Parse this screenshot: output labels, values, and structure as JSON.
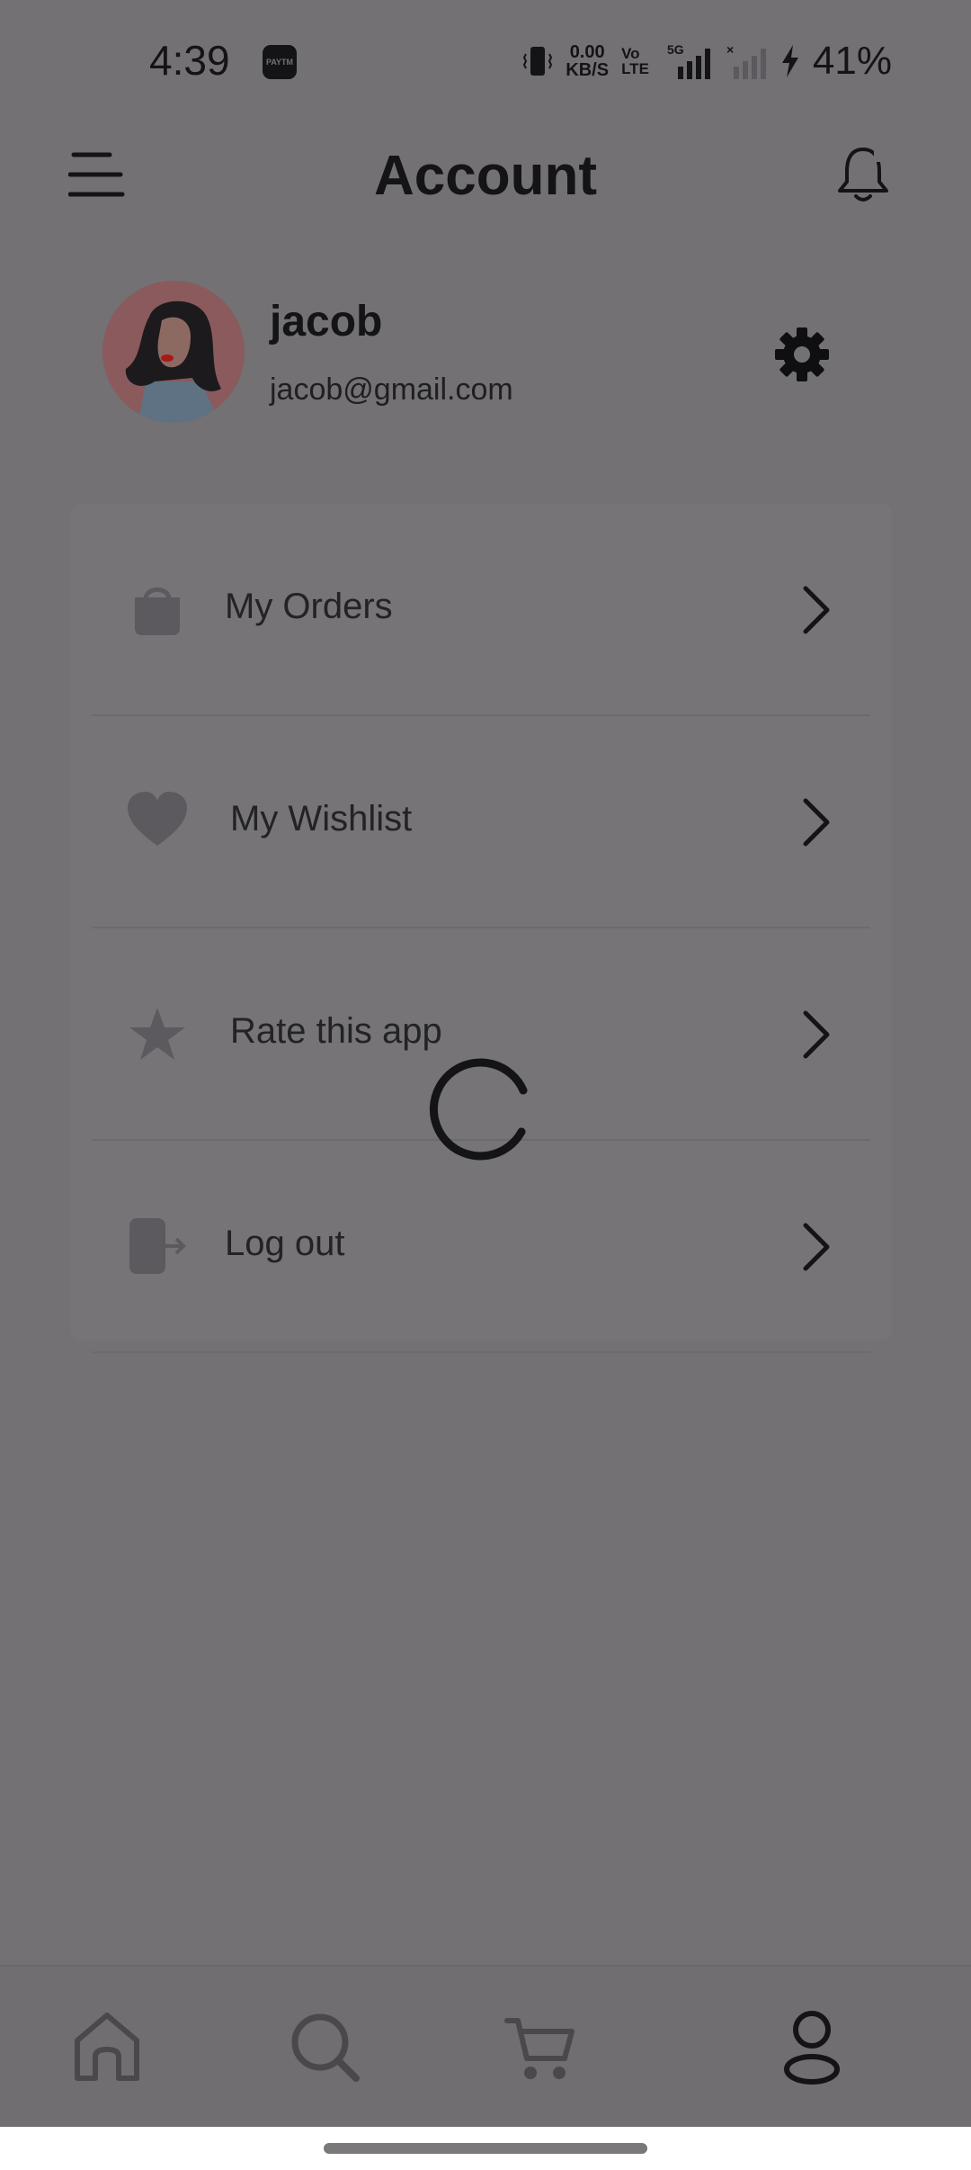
{
  "status_bar": {
    "time": "4:39",
    "paytm_label": "PAYTM",
    "net_speed_value": "0.00",
    "net_speed_unit": "KB/S",
    "volte_top": "Vo",
    "volte_bottom": "LTE",
    "network": "5G",
    "battery": "41%"
  },
  "header": {
    "title": "Account"
  },
  "profile": {
    "name": "jacob",
    "email": "jacob@gmail.com"
  },
  "menu": {
    "items": [
      {
        "label": "My Orders",
        "icon": "shopping-bag-icon"
      },
      {
        "label": "My Wishlist",
        "icon": "heart-icon"
      },
      {
        "label": "Rate this app",
        "icon": "star-icon"
      },
      {
        "label": "Log out",
        "icon": "logout-icon"
      }
    ]
  },
  "bottom_nav": {
    "items": [
      "home-icon",
      "search-icon",
      "cart-icon",
      "profile-icon"
    ],
    "active": "profile-icon"
  },
  "colors": {
    "overlay_background": "#737174",
    "text_dark": "#141316",
    "icon_gray": "#5c5a5e"
  }
}
